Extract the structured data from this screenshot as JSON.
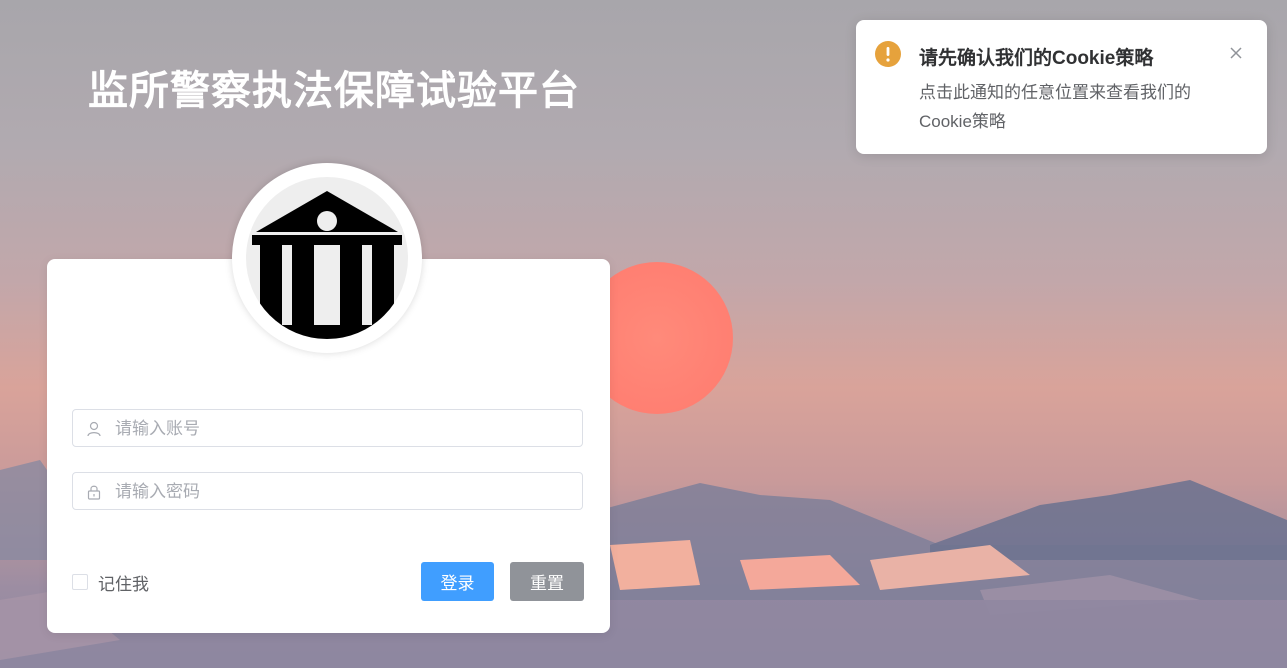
{
  "page": {
    "title": "监所警察执法保障试验平台"
  },
  "avatar": {
    "icon": "bank-building-icon"
  },
  "login_form": {
    "username": {
      "placeholder": "请输入账号",
      "value": "",
      "icon": "user-icon"
    },
    "password": {
      "placeholder": "请输入密码",
      "value": "",
      "icon": "lock-icon"
    },
    "remember_label": "记住我",
    "remember_checked": false,
    "login_button": "登录",
    "reset_button": "重置"
  },
  "notification": {
    "icon": "warning-icon",
    "title": "请先确认我们的Cookie策略",
    "message": "点击此通知的任意位置来查看我们的Cookie策略",
    "close_icon": "close-icon"
  },
  "colors": {
    "primary": "#409eff",
    "info": "#909399",
    "warning": "#e6a23c",
    "title_text": "#ffffff"
  }
}
